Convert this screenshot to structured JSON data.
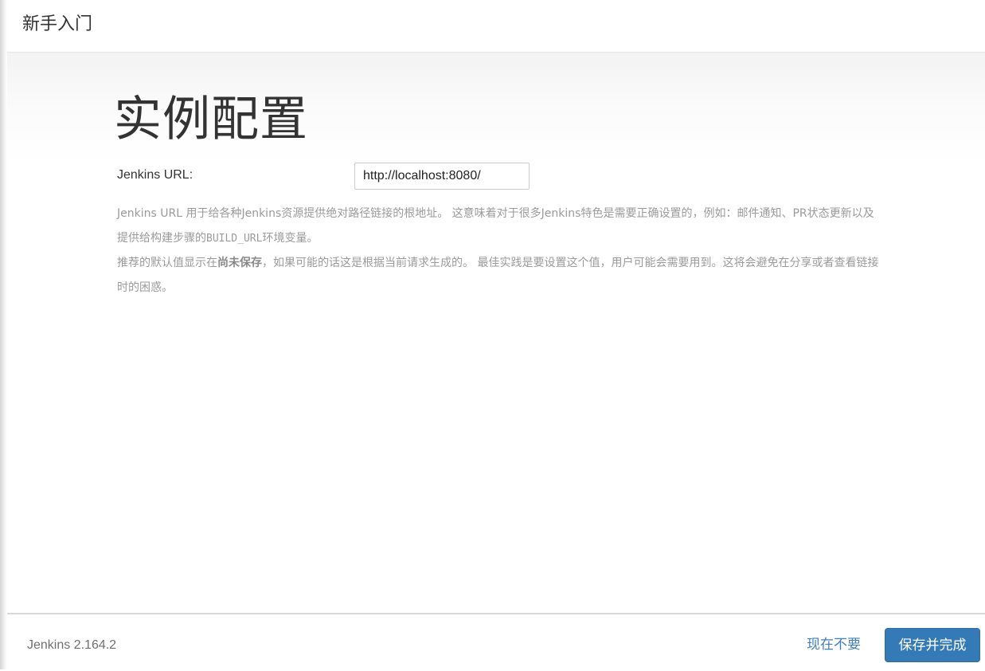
{
  "header": {
    "title": "新手入门"
  },
  "main": {
    "title": "实例配置",
    "url_label": "Jenkins URL:",
    "url_value": "http://localhost:8080/",
    "help": {
      "p1_a": "Jenkins URL 用于给各种Jenkins资源提供绝对路径链接的根地址。 这意味着对于很多Jenkins特色是需要正确设置的，例如：邮件通知、PR状态更新以及提供给构建步骤的",
      "p1_code": "BUILD_URL",
      "p1_b": "环境变量。",
      "p2_a": "推荐的默认值显示在",
      "p2_bold": "尚未保存",
      "p2_b": "，如果可能的话这是根据当前请求生成的。 最佳实践是要设置这个值，用户可能会需要用到。这将会避免在分享或者查看链接时的困惑。"
    }
  },
  "footer": {
    "version": "Jenkins 2.164.2",
    "skip_label": "现在不要",
    "save_label": "保存并完成"
  },
  "colors": {
    "primary": "#337ab7",
    "link": "#3f7fba"
  }
}
